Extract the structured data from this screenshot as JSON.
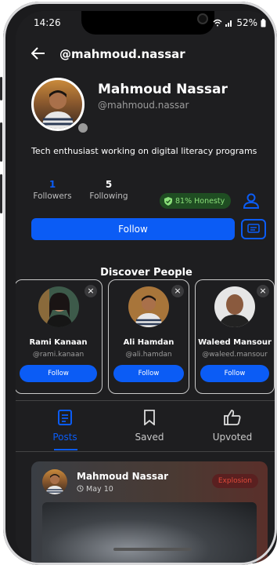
{
  "status_bar": {
    "time": "14:26",
    "battery": "52%"
  },
  "header": {
    "title": "@mahmoud.nassar",
    "back_icon": "arrow-left-icon"
  },
  "profile": {
    "name": "Mahmoud Nassar",
    "username": "@mahmoud.nassar",
    "bio": "Tech enthusiast working on digital literacy programs",
    "followers_count": "1",
    "followers_label": "Followers",
    "following_count": "5",
    "following_label": "Following",
    "honesty": "81% Honesty",
    "follow_label": "Follow"
  },
  "discover": {
    "title": "Discover People",
    "people": [
      {
        "name": "Rami Kanaan",
        "username": "@rami.kanaan",
        "follow_label": "Follow"
      },
      {
        "name": "Ali Hamdan",
        "username": "@ali.hamdan",
        "follow_label": "Follow"
      },
      {
        "name": "Waleed Mansour",
        "username": "@waleed.mansour",
        "follow_label": "Follow"
      }
    ]
  },
  "tabs": [
    {
      "label": "Posts",
      "icon": "document-icon",
      "active": true
    },
    {
      "label": "Saved",
      "icon": "bookmark-icon",
      "active": false
    },
    {
      "label": "Upvoted",
      "icon": "thumbs-up-icon",
      "active": false
    }
  ],
  "post": {
    "author": "Mahmoud Nassar",
    "date": "May 10",
    "tag": "Explosion"
  },
  "colors": {
    "accent": "#0b5cf5",
    "background": "#1e1e20",
    "honesty": "#8be07a",
    "tag": "#e04a3a"
  }
}
